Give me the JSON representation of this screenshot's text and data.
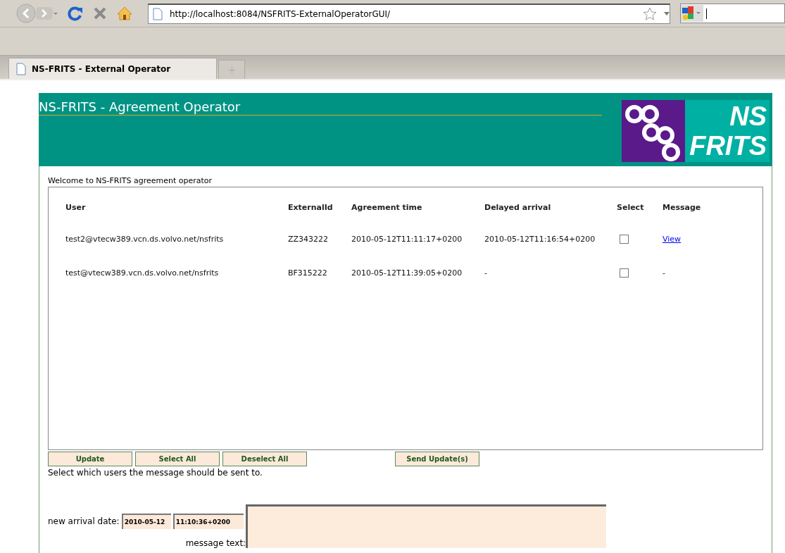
{
  "browser": {
    "url": "http://localhost:8084/NSFRITS-ExternalOperatorGUI/",
    "tabs": [
      {
        "title": "NS-FRITS - External Operator",
        "selected": true
      }
    ]
  },
  "header": {
    "title": "NS-FRITS - Agreement Operator",
    "logo_lines": [
      "NS",
      "FRITS"
    ]
  },
  "welcome": "Welcome to NS-FRITS agreement operator",
  "table": {
    "columns": [
      "User",
      "ExternalId",
      "Agreement time",
      "Delayed arrival",
      "Select",
      "Message"
    ],
    "rows": [
      {
        "user": "test2@vtecw389.vcn.ds.volvo.net/nsfrits",
        "external_id": "ZZ343222",
        "agreement_time": "2010-05-12T11:11:17+0200",
        "delayed_arrival": "2010-05-12T11:16:54+0200",
        "checked": false,
        "message": {
          "kind": "link",
          "text": "View"
        }
      },
      {
        "user": "test@vtecw389.vcn.ds.volvo.net/nsfrits",
        "external_id": "BF315222",
        "agreement_time": "2010-05-12T11:39:05+0200",
        "delayed_arrival": "-",
        "checked": false,
        "message": {
          "kind": "text",
          "text": "-"
        }
      }
    ]
  },
  "buttons": [
    "Update",
    "Select All",
    "Deselect All"
  ],
  "send_button": "Send Update(s)",
  "hint": "Select which users the message should be sent to.",
  "arrival": {
    "label": "new arrival date:",
    "date": "2010-05-12",
    "time": "11:10:36+0200"
  },
  "message_label": "message text:"
}
